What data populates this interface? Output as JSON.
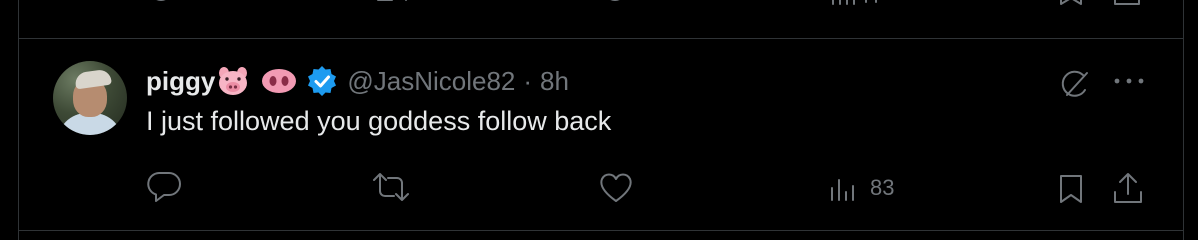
{
  "tweet": {
    "display_name": "piggy",
    "handle": "@JasNicole82",
    "separator": "·",
    "time": "8h",
    "text": "I just followed you goddess follow back",
    "verified": true,
    "views": "83"
  },
  "icons": {
    "reply": "reply-icon",
    "repost": "repost-icon",
    "like": "like-icon",
    "views": "views-icon",
    "bookmark": "bookmark-icon",
    "share": "share-icon",
    "grok": "grok-icon",
    "more": "more-icon"
  },
  "colors": {
    "background": "#000000",
    "text": "#e7e9ea",
    "muted": "#71767b",
    "border": "#2f3336",
    "verified": "#1d9bf0"
  }
}
